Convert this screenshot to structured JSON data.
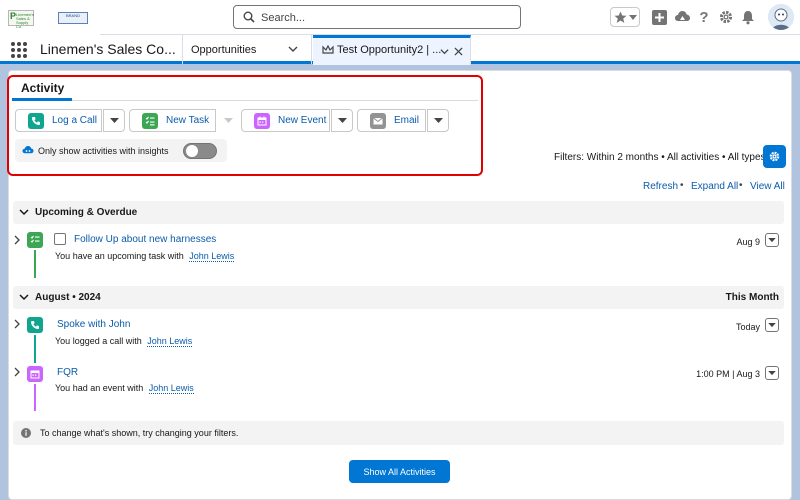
{
  "header": {
    "logo_left_text": "Linemen's Sales & Supply Co.",
    "logo_right_text": "BRAND",
    "search_placeholder": "Search..."
  },
  "nav": {
    "app_name": "Linemen's Sales Co...",
    "tabs": [
      {
        "label": "Opportunities"
      },
      {
        "label": "Test Opportunity2 | ..."
      }
    ]
  },
  "activity": {
    "tab_label": "Activity",
    "buttons": {
      "log_call": "Log a Call",
      "new_task": "New Task",
      "new_event": "New Event",
      "email": "Email"
    },
    "insights_label": "Only show activities with insights",
    "insights_toggle_on": false,
    "filters_text": "Filters: Within 2 months • All activities • All types",
    "links": {
      "refresh": "Refresh",
      "expand_all": "Expand All",
      "view_all": "View All"
    },
    "sections": {
      "upcoming": {
        "title": "Upcoming & Overdue",
        "items": [
          {
            "subject": "Follow Up about new harnesses",
            "body": "You have an upcoming task with",
            "who": "John Lewis",
            "date": "Aug 9",
            "type": "task"
          }
        ]
      },
      "august": {
        "title": "August • 2024",
        "right": "This Month",
        "items": [
          {
            "subject": "Spoke with John",
            "body": "You logged a call with",
            "who": "John Lewis",
            "date": "Today",
            "type": "call"
          },
          {
            "subject": "FQR",
            "body": "You had an event with",
            "who": "John Lewis",
            "date": "1:00 PM | Aug 3",
            "type": "event"
          }
        ]
      }
    },
    "info_text": "To change what's shown, try changing your filters.",
    "show_all_label": "Show All Activities"
  },
  "colors": {
    "brand": "#0176d3",
    "call": "#0fa58e",
    "task": "#3ba755",
    "event": "#cb65ff",
    "email": "#939393",
    "highlight": "#e00000"
  }
}
